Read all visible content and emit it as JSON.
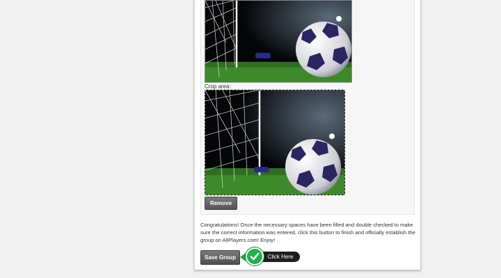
{
  "form": {
    "crop_label": "Crop area:",
    "remove_label": "Remove",
    "congrats_text": "Congratulations! Once the necessary spaces have been filled and double checked to make sure the correct information was entered, click this button to finish and officially establish the group on AllPlayers.com! Enjoy!",
    "save_label": "Save Group",
    "click_here_label": "Click Here"
  },
  "colors": {
    "page_bg": "#f1f1f1",
    "button_bg": "#555555",
    "callout_green": "#1fb24a",
    "callout_dark": "#1e1e1e"
  },
  "icons": [
    "checkmark-icon"
  ]
}
